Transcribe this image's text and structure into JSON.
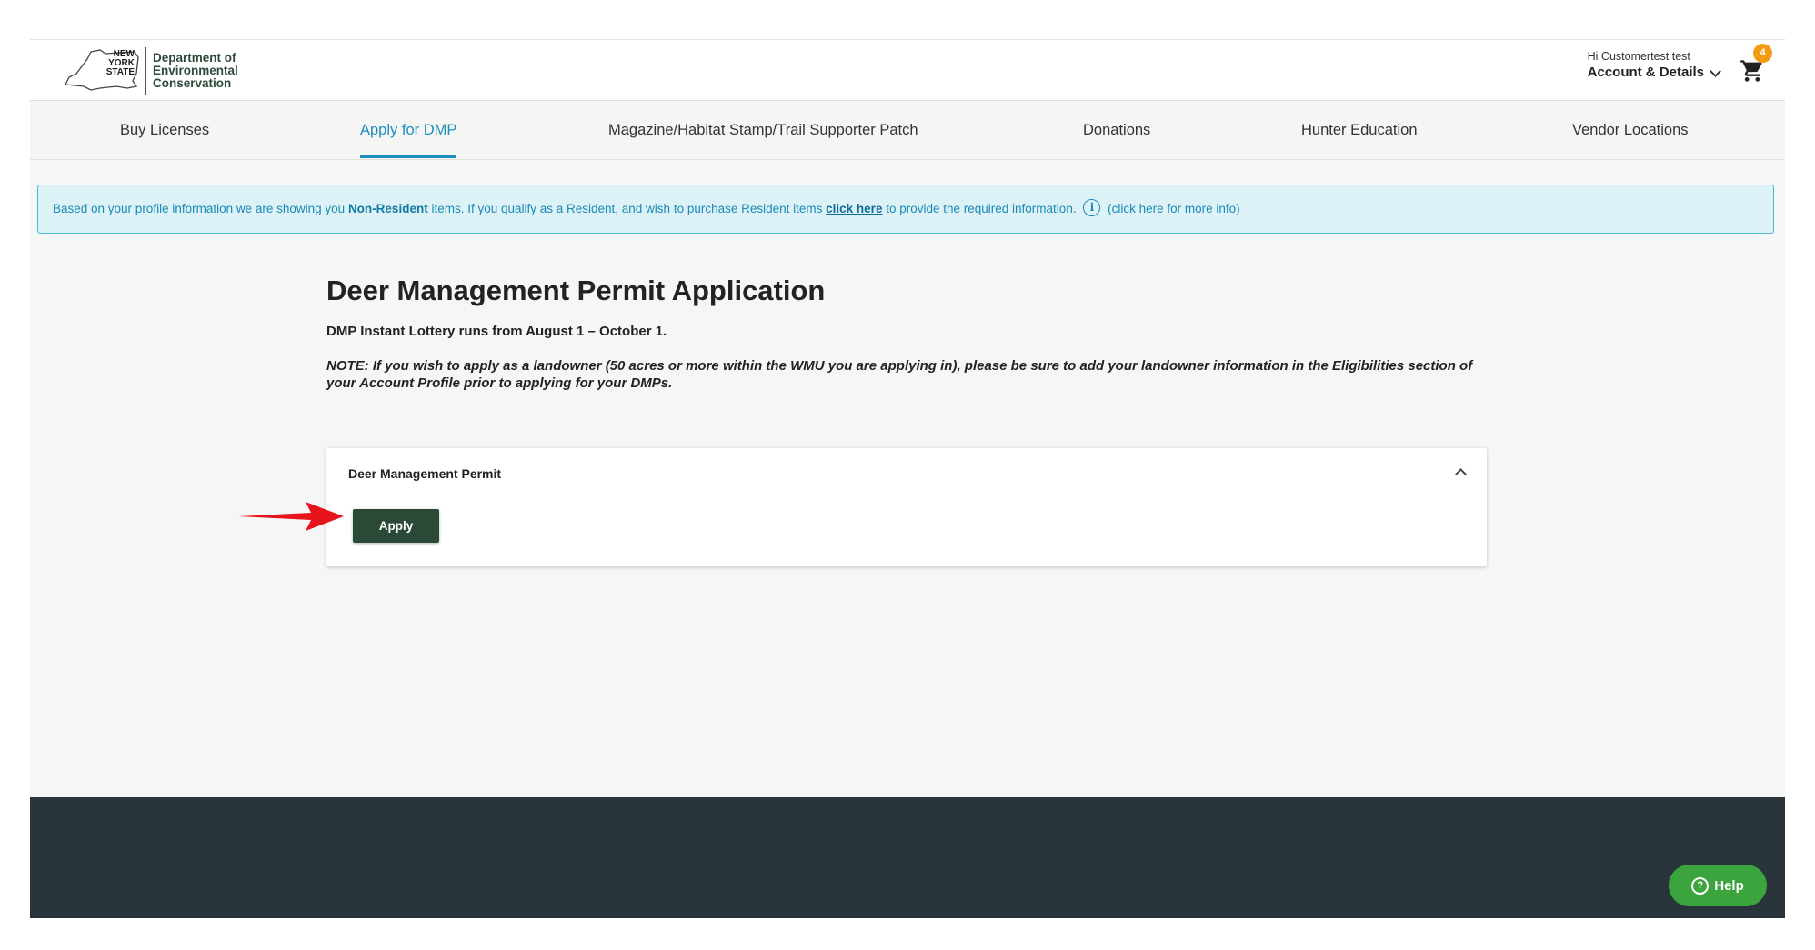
{
  "header": {
    "logo_state": "NEW YORK STATE",
    "logo_name": "Department of Environmental Conservation",
    "greeting": "Hi Customertest test",
    "account_label": "Account & Details",
    "cart_count": "4"
  },
  "nav": {
    "items": [
      {
        "label": "Buy Licenses"
      },
      {
        "label": "Apply for DMP",
        "active": true
      },
      {
        "label": "Magazine/Habitat Stamp/Trail Supporter Patch"
      },
      {
        "label": "Donations"
      },
      {
        "label": "Hunter Education"
      },
      {
        "label": "Vendor Locations"
      }
    ]
  },
  "banner": {
    "text_1": "Based on your profile information we are showing you ",
    "status": "Non-Resident",
    "text_2": " items. If you qualify as a Resident, and wish to purchase Resident items ",
    "link": "click here",
    "text_3": " to provide the required information.",
    "more_info": "(click here for more info)"
  },
  "main": {
    "title": "Deer Management Permit Application",
    "lottery_note": "DMP Instant Lottery runs from August 1 – October 1.",
    "landowner_note": "NOTE:  If you wish to apply as a landowner (50 acres or more within the WMU you are applying in), please be sure to add your landowner information in the Eligibilities section of your Account Profile prior to applying for your DMPs."
  },
  "permit_card": {
    "title": "Deer Management Permit",
    "apply_label": "Apply"
  },
  "footer": {
    "help_label": "Help"
  },
  "colors": {
    "accent": "#1e8fc0",
    "apply_button": "#2a4a37",
    "help_button": "#3ca43c",
    "footer": "#2a343b",
    "annotation_arrow": "#e8141b"
  }
}
